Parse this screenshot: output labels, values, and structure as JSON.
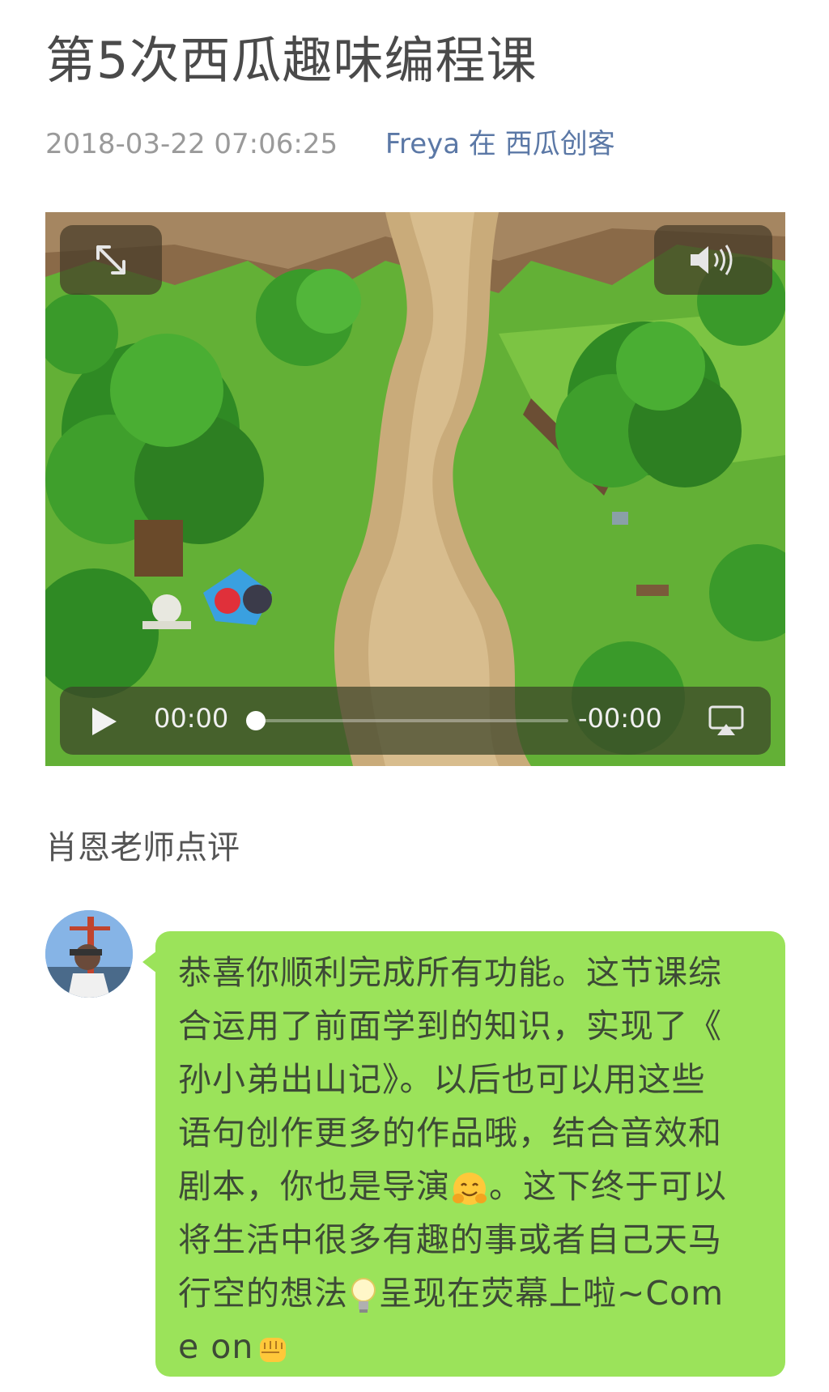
{
  "article": {
    "title": "第5次西瓜趣味编程课",
    "date": "2018-03-22 07:06:25",
    "author_line": "Freya 在 西瓜创客"
  },
  "video": {
    "current_time": "00:00",
    "remaining_time": "-00:00",
    "progress": 0,
    "icons": [
      "expand-icon",
      "speaker-icon",
      "play-icon",
      "airplay-icon"
    ]
  },
  "review": {
    "heading": "肖恩老师点评",
    "lines": [
      "恭喜你顺利完成所有功能。这节课综",
      "合运用了前面学到的知识，实现了《",
      "孙小弟出山记》。以后也可以用这些",
      "语句创作更多的作品哦，结合音效和",
      "剧本，你也是导演",
      "。这下终于可以",
      "将生活中很多有趣的事或者自己天马",
      "行空的想法",
      "呈现在荧幕上啦~Com",
      "e on"
    ],
    "emojis": [
      "hugging-face-emoji",
      "light-bulb-emoji",
      "fist-emoji"
    ],
    "bubble_color": "#9be35a"
  }
}
